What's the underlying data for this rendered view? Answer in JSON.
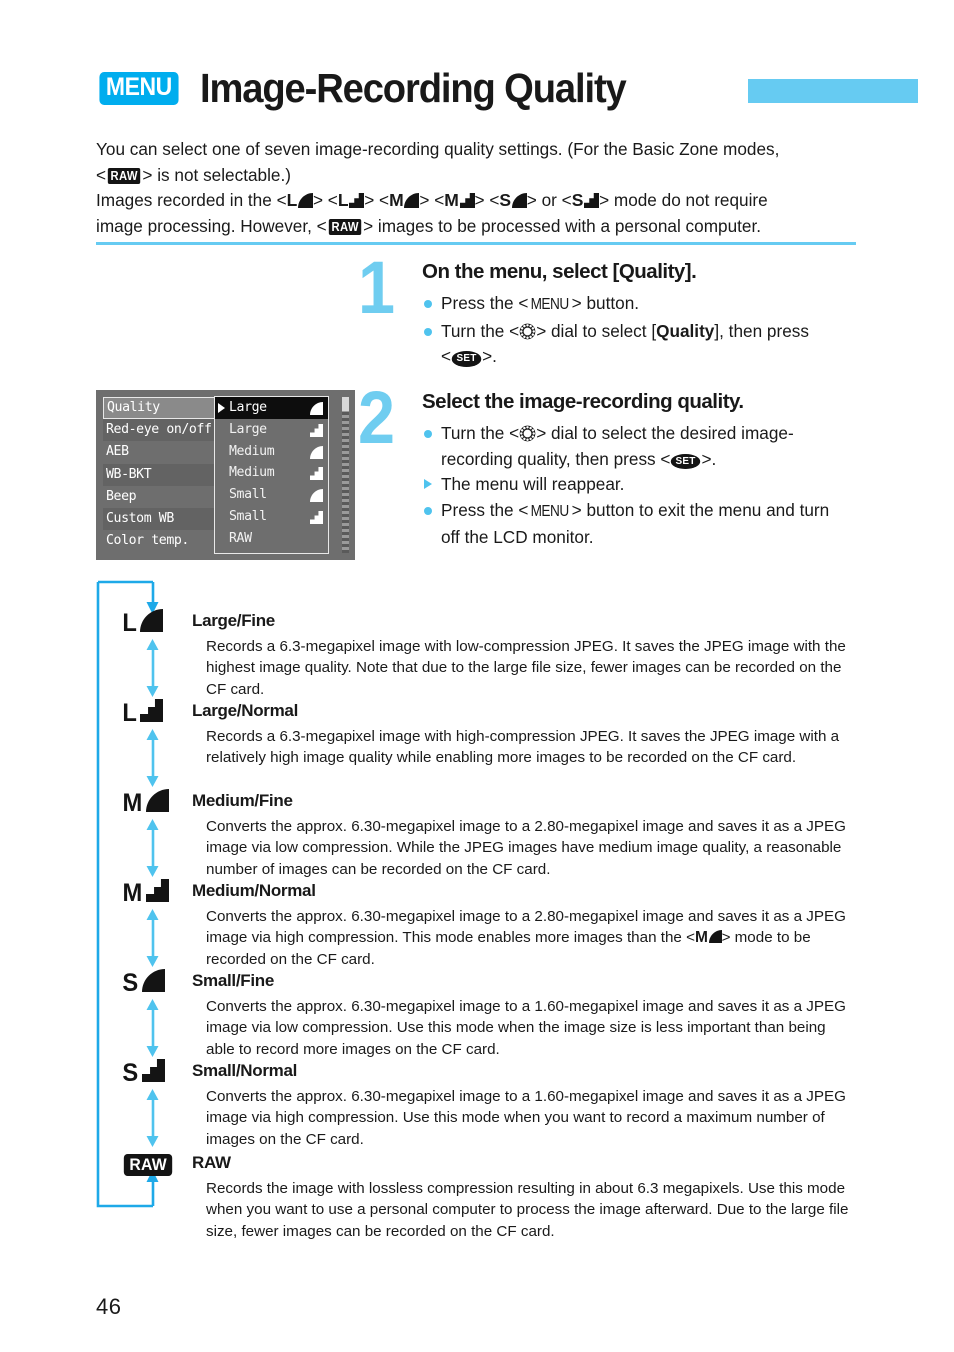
{
  "header": {
    "menu_badge": "MENU",
    "title": "Image-Recording Quality"
  },
  "intro": {
    "line1_a": "You can select one of seven image-recording quality settings. (For the Basic Zone modes,",
    "line2_raw": "RAW",
    "line2_b": "is not selectable.)",
    "line3_a": "Images recorded in the",
    "line3_or": "or",
    "line3_b": "mode do not require",
    "line4_a": "image processing. However,",
    "line4_raw": "RAW",
    "line4_b": "images to be processed with a personal computer."
  },
  "steps": [
    {
      "number": "1",
      "heading": "On the menu, select [Quality].",
      "lines": [
        {
          "marker": "dot",
          "a": "Press the <",
          "icon": "MENU",
          "b": "> button."
        },
        {
          "marker": "dot",
          "a": "Turn the <",
          "icon": "dial",
          "b": "> dial to select [",
          "bold": "Quality",
          "c": "], then press"
        },
        {
          "marker": "none",
          "a": "<",
          "icon": "SET",
          "b": ">."
        }
      ]
    },
    {
      "number": "2",
      "heading": "Select the image-recording quality.",
      "lines": [
        {
          "marker": "dot",
          "a": "Turn the <",
          "icon": "dial",
          "b": "> dial to select the desired image-"
        },
        {
          "marker": "none",
          "a": "recording quality, then press <",
          "icon": "SET",
          "b": ">."
        },
        {
          "marker": "tri",
          "a": "The menu will reappear."
        },
        {
          "marker": "dot",
          "a": "Press the <",
          "icon": "MENU",
          "b": "> button to exit the menu and turn"
        },
        {
          "marker": "none",
          "a": "off the LCD monitor."
        }
      ]
    }
  ],
  "lcd": {
    "left_items": [
      "Quality",
      "Red-eye on/off",
      "AEB",
      "WB-BKT",
      "Beep",
      "Custom WB",
      "Color temp."
    ],
    "dropdown_items": [
      {
        "label": "Large",
        "icon": "fine",
        "selected": true
      },
      {
        "label": "Large",
        "icon": "normal",
        "selected": false
      },
      {
        "label": "Medium",
        "icon": "fine",
        "selected": false
      },
      {
        "label": "Medium",
        "icon": "normal",
        "selected": false
      },
      {
        "label": "Small",
        "icon": "fine",
        "selected": false
      },
      {
        "label": "Small",
        "icon": "normal",
        "selected": false
      },
      {
        "label": "RAW",
        "icon": "none",
        "selected": false
      }
    ]
  },
  "quality_entries": [
    {
      "letter": "L",
      "icon": "fine",
      "title": "Large/Fine",
      "desc": "Records a 6.3-megapixel image with low-compression JPEG. It saves the JPEG image with the highest image quality. Note that due to the large file size, fewer images can be recorded on the CF card."
    },
    {
      "letter": "L",
      "icon": "normal",
      "title": "Large/Normal",
      "desc": "Records a 6.3-megapixel image with high-compression JPEG. It saves the JPEG image with a relatively high image quality while enabling more images to be recorded on the CF card."
    },
    {
      "letter": "M",
      "icon": "fine",
      "title": "Medium/Fine",
      "desc": "Converts the approx. 6.30-megapixel image to a 2.80-megapixel image and saves it as a JPEG image via low compression. While the JPEG images have medium image quality, a reasonable number of images can be recorded on the CF card."
    },
    {
      "letter": "M",
      "icon": "normal",
      "title": "Medium/Normal",
      "desc_a": "Converts the approx. 6.30-megapixel image to a 2.80-megapixel image and saves it as a JPEG image via high compression. This mode enables more images than the <",
      "desc_icon_letter": "M",
      "desc_b": "> mode to be recorded on the CF card."
    },
    {
      "letter": "S",
      "icon": "fine",
      "title": "Small/Fine",
      "desc": "Converts the approx. 6.30-megapixel image to a 1.60-megapixel image and saves it as a JPEG image via low compression. Use this mode when the image size is less important than being able to record more images on the CF card."
    },
    {
      "letter": "S",
      "icon": "normal",
      "title": "Small/Normal",
      "desc": "Converts the approx. 6.30-megapixel image to a 1.60-megapixel image and saves it as a JPEG image via high compression. Use this mode when you want to record a maximum number of images on the CF card."
    },
    {
      "letter": "RAW",
      "icon": "raw",
      "title": "RAW",
      "desc": "Records the image with lossless compression resulting in about 6.3 megapixels. Use this mode when you want to use a personal computer to process the image afterward. Due to the large file size, fewer images can be recorded on the CF card."
    }
  ],
  "footer": {
    "page_number": "46"
  },
  "colors": {
    "accent_cyan": "#66CBF2",
    "badge_cyan": "#00ADEE",
    "step_number": "#6FCDF0",
    "ink": "#191919"
  }
}
